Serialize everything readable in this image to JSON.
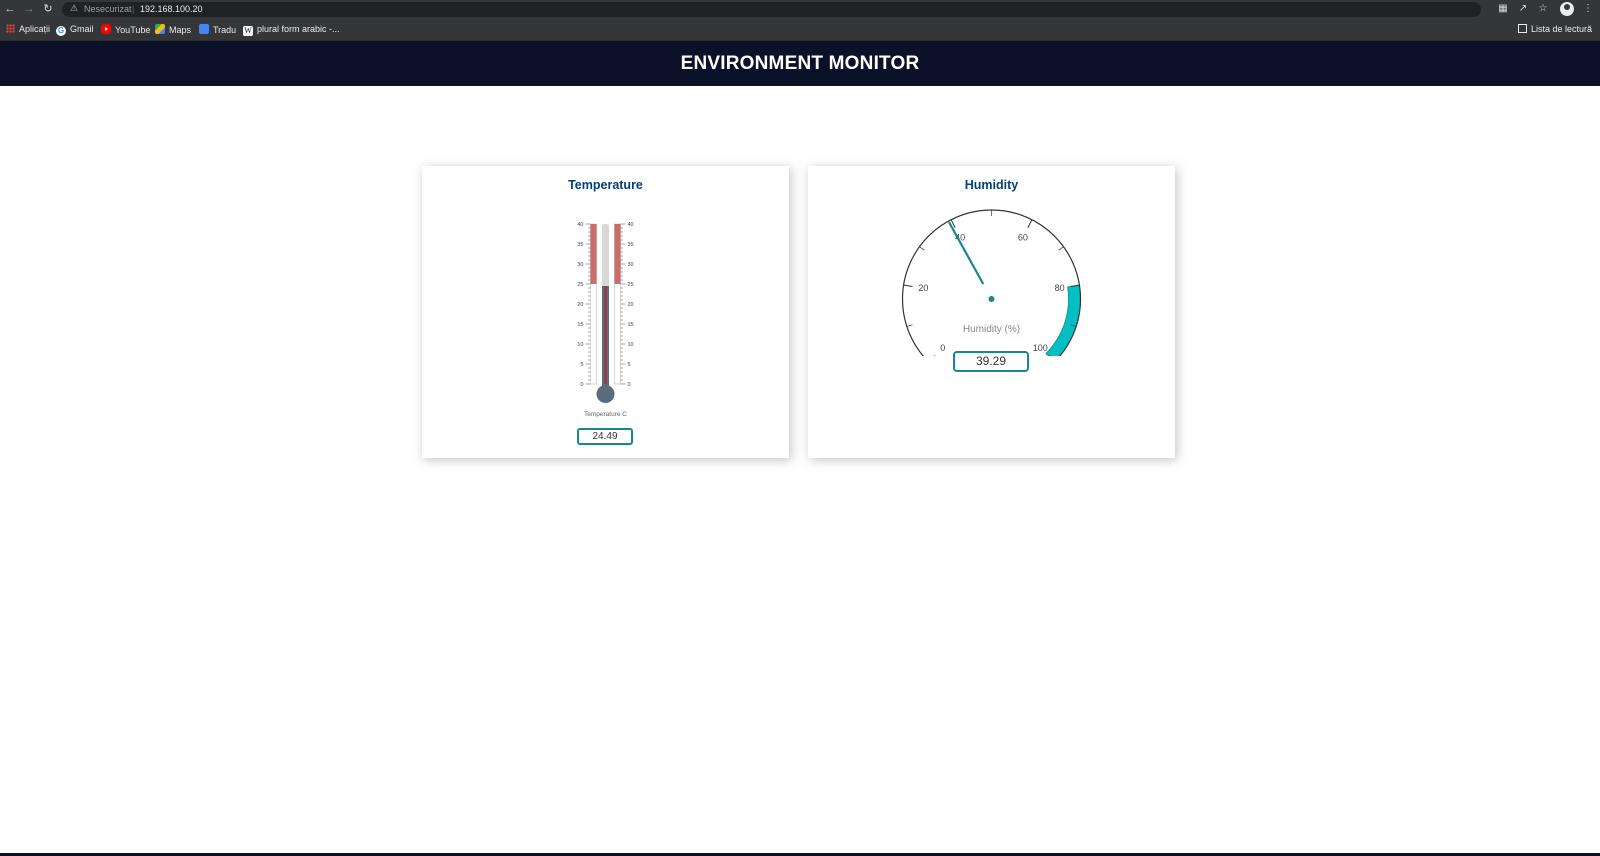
{
  "browser": {
    "security_label": "Nesecurizat",
    "separator": "|",
    "url": "192.168.100.20",
    "bookmarks": [
      {
        "label": "Aplicații",
        "icon": "apps-grid-icon"
      },
      {
        "label": "Gmail",
        "icon": "google-icon"
      },
      {
        "label": "YouTube",
        "icon": "youtube-icon"
      },
      {
        "label": "Maps",
        "icon": "maps-icon"
      },
      {
        "label": "Tradu",
        "icon": "translate-icon"
      },
      {
        "label": "plural form arabic -...",
        "icon": "wiki-icon"
      }
    ],
    "reading_list": "Lista de lectură"
  },
  "header": {
    "title": "ENVIRONMENT MONITOR",
    "bg_color": "#0a1129"
  },
  "temperature": {
    "title": "Temperature",
    "axis_label": "Temperature C",
    "value_text": "24.49",
    "accent": "#16888e"
  },
  "humidity": {
    "title": "Humidity",
    "axis_label": "Humidity (%)",
    "value_text": "39.29",
    "accent": "#16888e",
    "band_color": "#00c0c3"
  },
  "chart_data": [
    {
      "type": "linear-gauge",
      "name": "thermometer",
      "axis_label": "Temperature C",
      "ylim": [
        0,
        40
      ],
      "major_ticks": [
        0,
        5,
        10,
        15,
        20,
        25,
        30,
        35,
        40
      ],
      "value": 24.49,
      "highlight_range": [
        25,
        40
      ],
      "highlight_color": "#c75050",
      "bar_color": "#5a6b79",
      "fill_color": "#8a3a44"
    },
    {
      "type": "radial-gauge",
      "name": "humidity-gauge",
      "axis_label": "Humidity (%)",
      "ylim": [
        0,
        100
      ],
      "major_ticks": [
        0,
        20,
        40,
        60,
        80,
        100
      ],
      "value": 39.29,
      "highlight_range": [
        80,
        100
      ],
      "highlight_color": "#00c0c3",
      "needle_color": "#16888e"
    }
  ]
}
